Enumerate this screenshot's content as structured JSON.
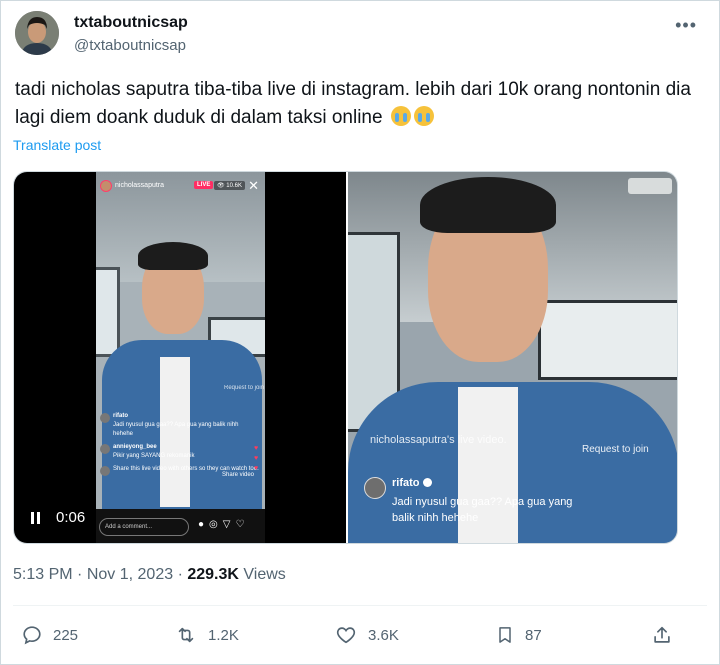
{
  "author": {
    "display_name": "txtaboutnicsap",
    "handle": "@txtaboutnicsap"
  },
  "tweet": {
    "text": "tadi nicholas saputra tiba-tiba live di instagram. lebih dari 10k orang nontonin dia lagi diem doank duduk di dalam taksi online",
    "emoji": "loudly-crying-face x2",
    "translate_label": "Translate post"
  },
  "media_left": {
    "ig_username": "nicholassaputra",
    "live_badge": "LIVE",
    "viewer_count": "10.6K",
    "request_label": "Request to join",
    "comments": [
      {
        "user": "rifato",
        "text": "Jadi nyusul gua gaa?? Apa gua yang balik nihh hehehe"
      },
      {
        "user": "annieyong_bee",
        "text": "Pikir yang SAYANG rekomanik"
      },
      {
        "user": "",
        "text": "Share this live video with others so they can watch too."
      }
    ],
    "share_label": "Share video",
    "comment_placeholder": "Add a comment...",
    "elapsed": "0:06"
  },
  "media_right": {
    "overlay_text": "nicholassaputra's live video.",
    "request_label": "Request to join",
    "comment_user": "rifato",
    "comment_text": "Jadi nyusul gua gaa?? Apa gua yang balik nihh hehehe"
  },
  "meta": {
    "time": "5:13 PM",
    "separator": "·",
    "date": "Nov 1, 2023",
    "views_count": "229.3K",
    "views_label": "Views"
  },
  "actions": {
    "replies": "225",
    "reposts": "1.2K",
    "likes": "3.6K",
    "bookmarks": "87"
  },
  "colors": {
    "link": "#1d9bf0",
    "secondary_text": "#536471",
    "live_badge": "#ff2e63"
  }
}
